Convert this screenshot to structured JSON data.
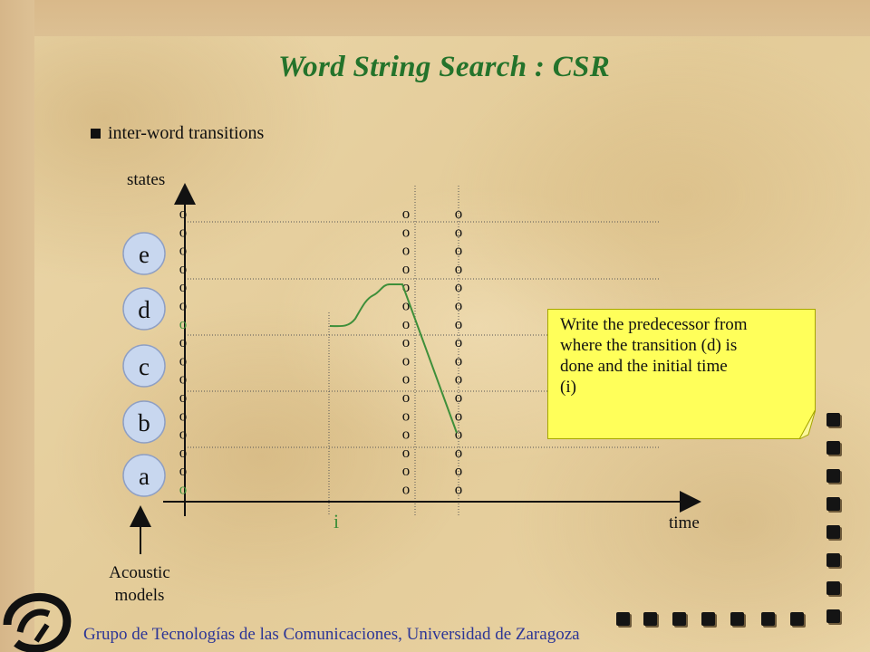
{
  "title": "Word String Search : CSR",
  "bullet": "inter-word transitions",
  "axes": {
    "y_label": "states",
    "x_label": "time"
  },
  "models": [
    "e",
    "d",
    "c",
    "b",
    "a"
  ],
  "models_caption_line1": "Acoustic",
  "models_caption_line2": "models",
  "state_symbol": "o",
  "initial_time_label": "i",
  "callout": {
    "line1": "Write the predecessor from",
    "line2": "where the transition (d) is",
    "line3": "done and the initial time",
    "line4": "(i)"
  },
  "footer": "Grupo de Tecnologías de las Comunicaciones,   Universidad de Zaragoza",
  "colors": {
    "title": "#24732b",
    "path": "#3e8f3a",
    "callout_bg": "#ffff5a",
    "footer": "#2c3596"
  },
  "icons": [
    "arrow-up-icon",
    "square-bullet-icon",
    "logo-icon",
    "square-decoration-icon"
  ]
}
